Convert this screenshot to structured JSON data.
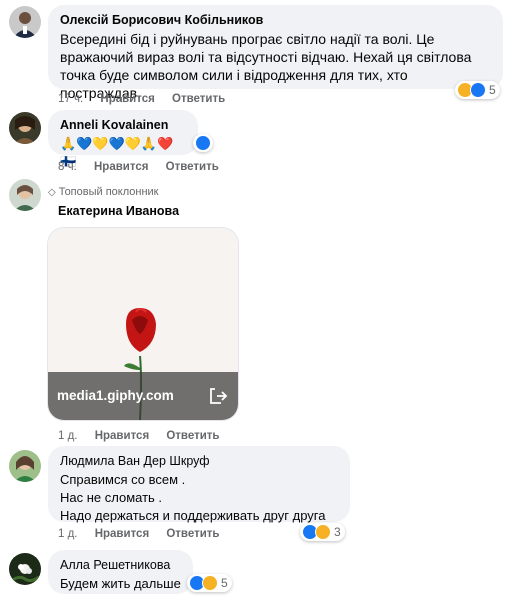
{
  "comments": [
    {
      "author": "Олексій Борисович Кобільников",
      "lines": [
        "Всередині бід і руйнувань програє світло надії та волі. Це",
        "вражаючий вираз волі та відсутності відчаю. Нехай ця світлова",
        "точка буде символом сили і відродження для тих, хто постраждав."
      ],
      "time": "17 ч.",
      "like_label": "Нравится",
      "reply_label": "Ответить",
      "reaction_count": "5"
    },
    {
      "author": "Anneli Kovalainen",
      "text": "🙏💙💛💙💛🙏❤️🇫🇮",
      "time": "8 ч.",
      "like_label": "Нравится",
      "reply_label": "Ответить"
    },
    {
      "badge": "Топовый поклонник",
      "author": "Екатерина Иванова",
      "gif_domain": "media1.giphy.com",
      "time": "1 д.",
      "like_label": "Нравится",
      "reply_label": "Ответить"
    },
    {
      "author": "Людмила Ван Дер Шкруф",
      "lines": [
        "Справимся со всем .",
        "Нас не сломать .",
        "Надо держаться и поддерживать друг друга"
      ],
      "time": "1 д.",
      "like_label": "Нравится",
      "reply_label": "Ответить",
      "reaction_count": "3"
    },
    {
      "author": "Алла Решетникова",
      "text": "Будем жить дальше",
      "reaction_count": "5"
    }
  ],
  "colors": {
    "bubble": "#f0f2f5",
    "meta_text": "#65676b",
    "like_blue": "#1877f2",
    "care_yellow": "#f7b125"
  }
}
